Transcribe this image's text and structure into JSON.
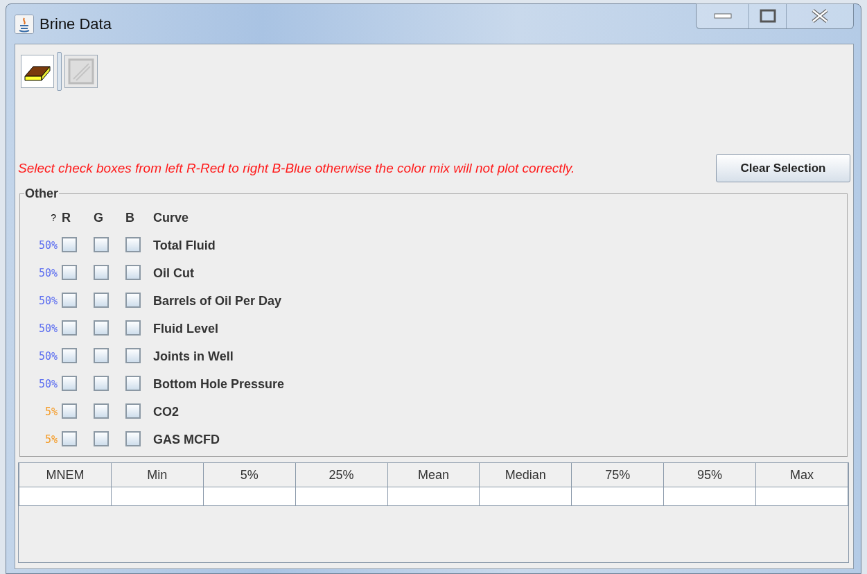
{
  "window": {
    "title": "Brine Data"
  },
  "toolbar": {
    "items": [
      {
        "kind": "eraser",
        "disabled": false
      },
      {
        "kind": "chart",
        "disabled": true
      }
    ]
  },
  "message": "Select check boxes from left R-Red to right B-Blue otherwise the color mix will not plot correctly.",
  "clear_button": "Clear Selection",
  "group": {
    "title": "Other",
    "header": {
      "mark": "?",
      "r": "R",
      "g": "G",
      "b": "B",
      "curve": "Curve"
    },
    "rows": [
      {
        "pct": "50%",
        "color": "#5a6cf0",
        "r": false,
        "g": false,
        "b": false,
        "curve": "Total Fluid"
      },
      {
        "pct": "50%",
        "color": "#5a6cf0",
        "r": false,
        "g": false,
        "b": false,
        "curve": "Oil Cut"
      },
      {
        "pct": "50%",
        "color": "#5a6cf0",
        "r": false,
        "g": false,
        "b": false,
        "curve": "Barrels of Oil Per Day"
      },
      {
        "pct": "50%",
        "color": "#5a6cf0",
        "r": false,
        "g": false,
        "b": false,
        "curve": "Fluid Level"
      },
      {
        "pct": "50%",
        "color": "#5a6cf0",
        "r": false,
        "g": false,
        "b": false,
        "curve": "Joints in Well"
      },
      {
        "pct": "50%",
        "color": "#5a6cf0",
        "r": false,
        "g": false,
        "b": false,
        "curve": "Bottom Hole Pressure"
      },
      {
        "pct": "5%",
        "color": "#f59a23",
        "r": false,
        "g": false,
        "b": false,
        "curve": "CO2"
      },
      {
        "pct": "5%",
        "color": "#f59a23",
        "r": false,
        "g": false,
        "b": false,
        "curve": "GAS MCFD"
      }
    ]
  },
  "table": {
    "columns": [
      "MNEM",
      "Min",
      "5%",
      "25%",
      "Mean",
      "Median",
      "75%",
      "95%",
      "Max"
    ]
  }
}
